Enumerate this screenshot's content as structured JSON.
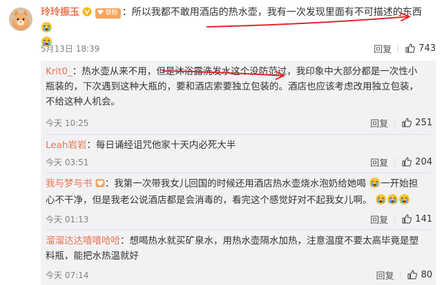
{
  "main_comment": {
    "username": "玲玲振玉",
    "fan_badge": "铁粉",
    "colon": "：",
    "text": "所以我都不敢用酒店的热水壶，我有一次发现里面有不可描述的东西",
    "time": "5月13日 18:39",
    "reply_label": "回复",
    "likes": "743"
  },
  "replies": [
    {
      "username": "Krit0_",
      "colon": "：",
      "text": "热水壶从来不用，但是沐浴露洗发水这个没防范过，我印象中大部分都是一次性小瓶装的，下次遇到这种大瓶的，要和酒店索要独立包装的。酒店也应该考虑改用独立包装，不给这种人机会。",
      "time": "今天 10:25",
      "reply_label": "回复",
      "likes": "251"
    },
    {
      "username": "Leah岩岩",
      "colon": "：",
      "text": "每日诵经诅咒他家十天内必死大半",
      "time": "今天 03:51",
      "reply_label": "回复",
      "likes": "204"
    },
    {
      "username": "我与梦与书",
      "colon": "：",
      "text_a": "我第一次带我女儿回国的时候还用酒店热水壶烧水泡奶给她喝",
      "text_b": "一开始担心不干净，但是我老公说酒店都是会消毒的，看完这个感觉好对不起我女儿啊。",
      "time": "今天 01:13",
      "reply_label": "回复",
      "likes": "141"
    },
    {
      "username": "溜溜达达嘻嘻哈哈",
      "colon": "：",
      "text": "想喝热水就买矿泉水，用热水壶隔水加热，注意温度不要太高毕竟是塑料瓶，能把水热温就好",
      "time": "今天 07:14",
      "reply_label": "回复",
      "likes": "80"
    }
  ],
  "colors": {
    "username": "#eb7350",
    "annotation_red": "#e0242a",
    "reply_bg": "#f2f2f5",
    "meta": "#808080"
  },
  "icons": [
    "avatar-cat",
    "vip-v-badge",
    "fan-badge",
    "crying-emoji",
    "like-thumb-icon"
  ]
}
